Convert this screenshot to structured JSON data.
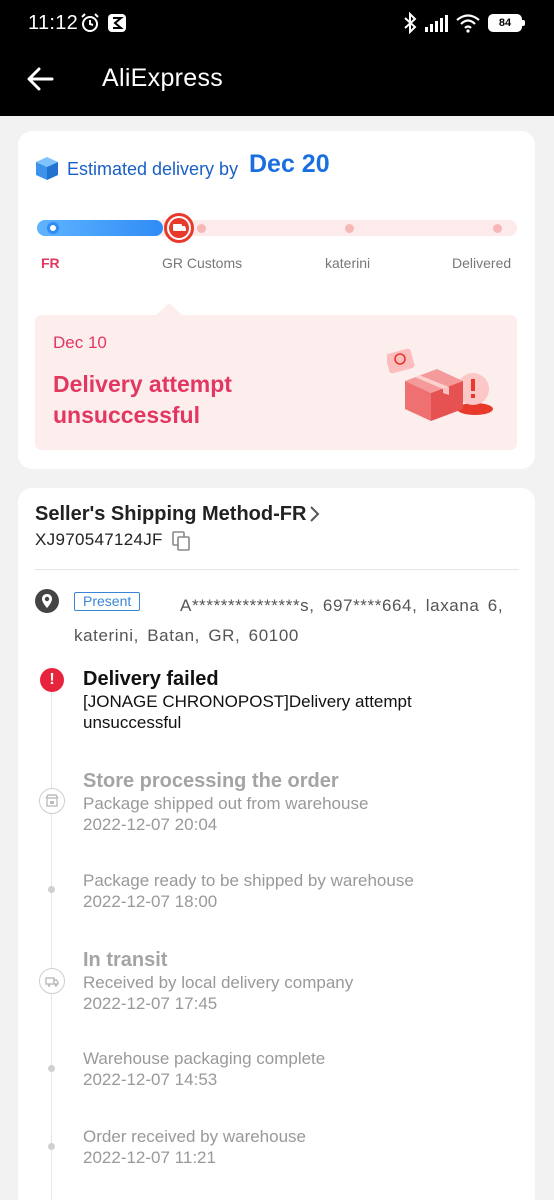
{
  "status_bar": {
    "time": "11:12",
    "battery": "84",
    "icons": [
      "alarm-icon",
      "app-notification-icon",
      "bluetooth-icon",
      "signal-icon",
      "wifi-icon",
      "battery-icon"
    ]
  },
  "app_bar": {
    "title": "AliExpress",
    "back_icon": "arrow-left-icon"
  },
  "delivery_summary": {
    "estimated_label": "Estimated delivery by",
    "estimated_date": "Dec 20",
    "stages": [
      {
        "label": "FR",
        "state": "done"
      },
      {
        "label": "GR Customs",
        "state": "current"
      },
      {
        "label": "katerini",
        "state": "pending"
      },
      {
        "label": "Delivered",
        "state": "pending"
      }
    ],
    "progress_fraction": 0.27,
    "latest": {
      "date": "Dec 10",
      "status": "Delivery attempt unsuccessful"
    }
  },
  "shipment": {
    "method": "Seller's Shipping Method-FR",
    "tracking_number": "XJ970547124JF",
    "address_badge": "Present",
    "address": "A***************s,  697****664,  laxana 6,  katerini,  Batan,  GR,  60100"
  },
  "timeline": [
    {
      "title": "Delivery failed",
      "desc": "[JONAGE CHRONOPOST]Delivery attempt unsuccessful",
      "time": "",
      "icon": "alert-icon"
    },
    {
      "title": "Store processing the order",
      "desc": "Package shipped out from warehouse",
      "time": "2022-12-07 20:04",
      "icon": "store-icon"
    },
    {
      "title": "",
      "desc": "Package ready to be shipped by warehouse",
      "time": "2022-12-07 18:00",
      "icon": "dot"
    },
    {
      "title": "In transit",
      "desc": "Received by local delivery company",
      "time": "2022-12-07 17:45",
      "icon": "truck-icon"
    },
    {
      "title": "",
      "desc": "Warehouse packaging complete",
      "time": "2022-12-07 14:53",
      "icon": "dot"
    },
    {
      "title": "",
      "desc": "Order received by warehouse",
      "time": "2022-12-07 11:21",
      "icon": "dot"
    }
  ],
  "colors": {
    "accent_red": "#e33660",
    "accent_blue": "#1a6fe0",
    "alert_red": "#e8233c"
  }
}
